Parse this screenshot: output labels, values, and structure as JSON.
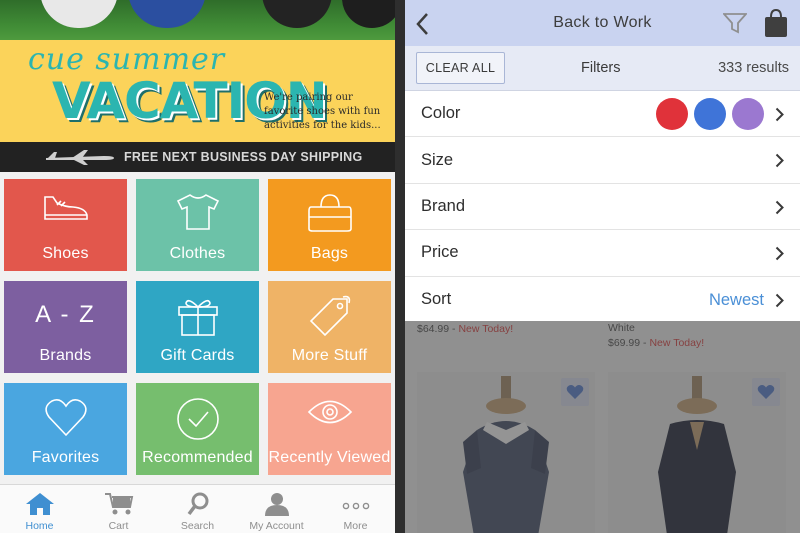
{
  "left_app": {
    "banner": {
      "script_text": "cue summer",
      "title": "VACATION",
      "copy": "We're pairing our favorite shoes with fun activities for the kids..."
    },
    "shipping": {
      "text": "FREE NEXT BUSINESS DAY SHIPPING",
      "icon": "airplane-icon"
    },
    "tiles": [
      {
        "label": "Shoes",
        "icon": "shoe-icon",
        "color": "#e2574c"
      },
      {
        "label": "Clothes",
        "icon": "tshirt-icon",
        "color": "#6cc2a8"
      },
      {
        "label": "Bags",
        "icon": "bag-icon",
        "color": "#f39a1f"
      },
      {
        "label": "Brands",
        "icon_text": "A - Z",
        "color": "#7d5fa0"
      },
      {
        "label": "Gift Cards",
        "icon": "gift-icon",
        "color": "#2fa6c4"
      },
      {
        "label": "More Stuff",
        "icon": "tag-icon",
        "color": "#efb366"
      },
      {
        "label": "Favorites",
        "icon": "heart-icon",
        "color": "#4aa6e0"
      },
      {
        "label": "Recommended",
        "icon": "checkmark-icon",
        "color": "#76be6e"
      },
      {
        "label": "Recently Viewed",
        "icon": "eye-icon",
        "color": "#f7a590"
      }
    ],
    "tabbar": [
      {
        "label": "Home",
        "icon": "home-icon",
        "active": true
      },
      {
        "label": "Cart",
        "icon": "cart-icon",
        "active": false
      },
      {
        "label": "Search",
        "icon": "search-icon",
        "active": false
      },
      {
        "label": "My Account",
        "icon": "account-icon",
        "active": false
      },
      {
        "label": "More",
        "icon": "more-icon",
        "active": false
      }
    ]
  },
  "right_app": {
    "navbar": {
      "title": "Back to Work"
    },
    "filterbar": {
      "clear_label": "CLEAR ALL",
      "title": "Filters",
      "results": "333 results"
    },
    "filters": [
      {
        "label": "Color"
      },
      {
        "label": "Size"
      },
      {
        "label": "Brand"
      },
      {
        "label": "Price"
      },
      {
        "label": "Sort",
        "value": "Newest"
      }
    ],
    "color_swatches": [
      "#e0323a",
      "#3f74d8",
      "#9b78d0"
    ],
    "accent_color": "#4a8fd6",
    "products": [
      {
        "price": "$64.99",
        "badge": "New Today!"
      },
      {
        "name": "White",
        "price": "$69.99",
        "badge": "New Today!"
      }
    ]
  }
}
